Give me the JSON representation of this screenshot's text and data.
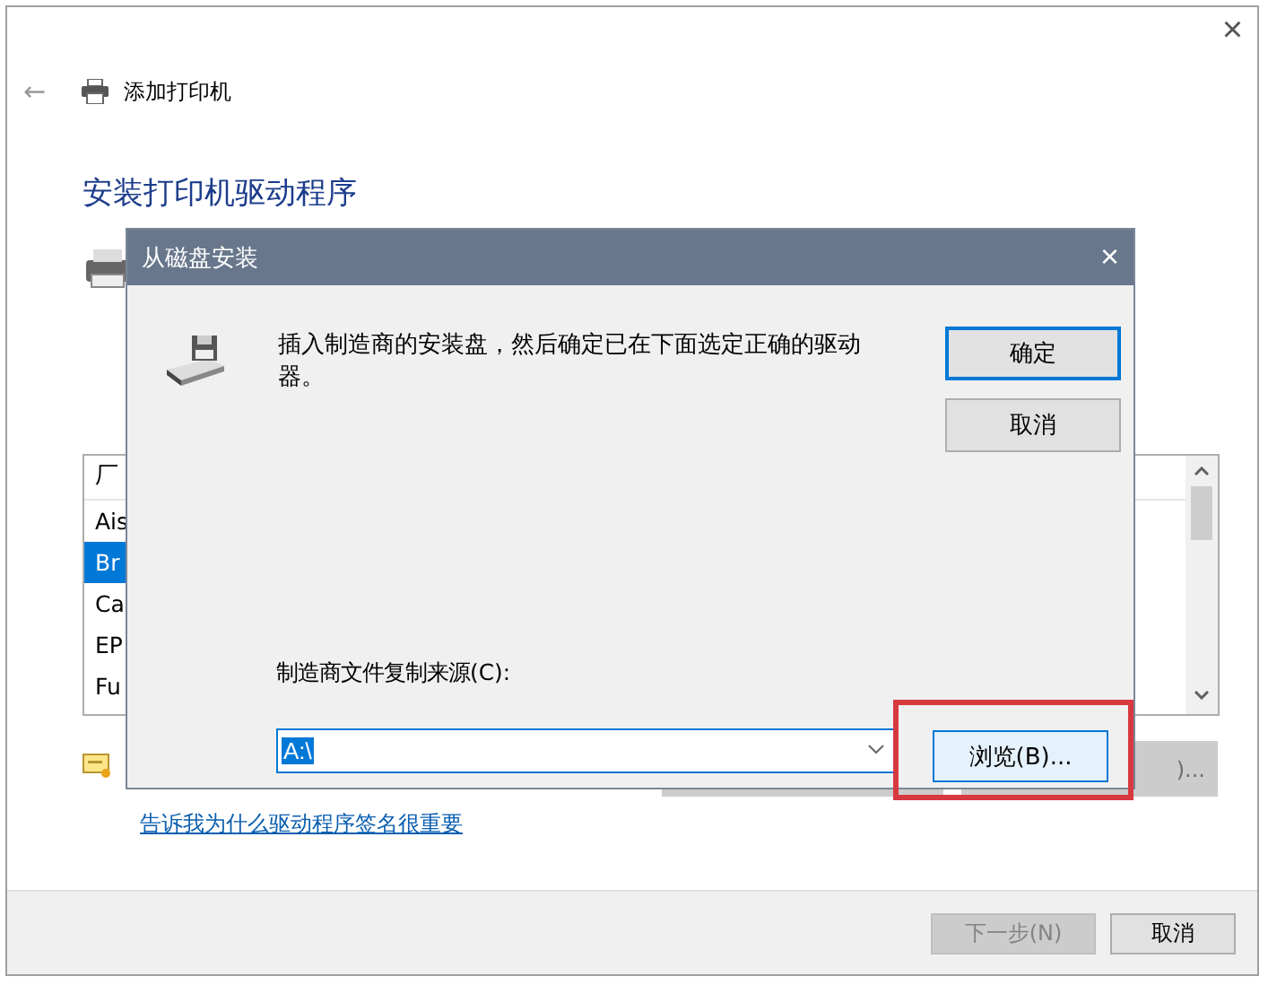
{
  "window": {
    "close": "×",
    "back": "←",
    "header_title": "添加打印机",
    "heading": "安装打印机驱动程序"
  },
  "manufacturers": {
    "header": "厂",
    "items": [
      {
        "label": "Ais",
        "selected": false
      },
      {
        "label": "Br",
        "selected": true
      },
      {
        "label": "Ca",
        "selected": false
      },
      {
        "label": "EP",
        "selected": false
      },
      {
        "label": "Fu",
        "selected": false
      }
    ]
  },
  "have_disk_button": ")...",
  "link": "告诉我为什么驱动程序签名很重要",
  "footer_buttons": [
    {
      "label": "下一步(N)",
      "disabled": true
    },
    {
      "label": "取消",
      "disabled": false
    }
  ],
  "dialog": {
    "title": "从磁盘安装",
    "close": "×",
    "message": "插入制造商的安装盘，然后确定已在下面选定正确的驱动器。",
    "buttons": [
      {
        "label": "确定",
        "default": true
      },
      {
        "label": "取消",
        "default": false
      }
    ],
    "source_label": "制造商文件复制来源(C):",
    "source_value": "A:\\",
    "browse_button": "浏览(B)...",
    "browse_highlighted": true
  }
}
